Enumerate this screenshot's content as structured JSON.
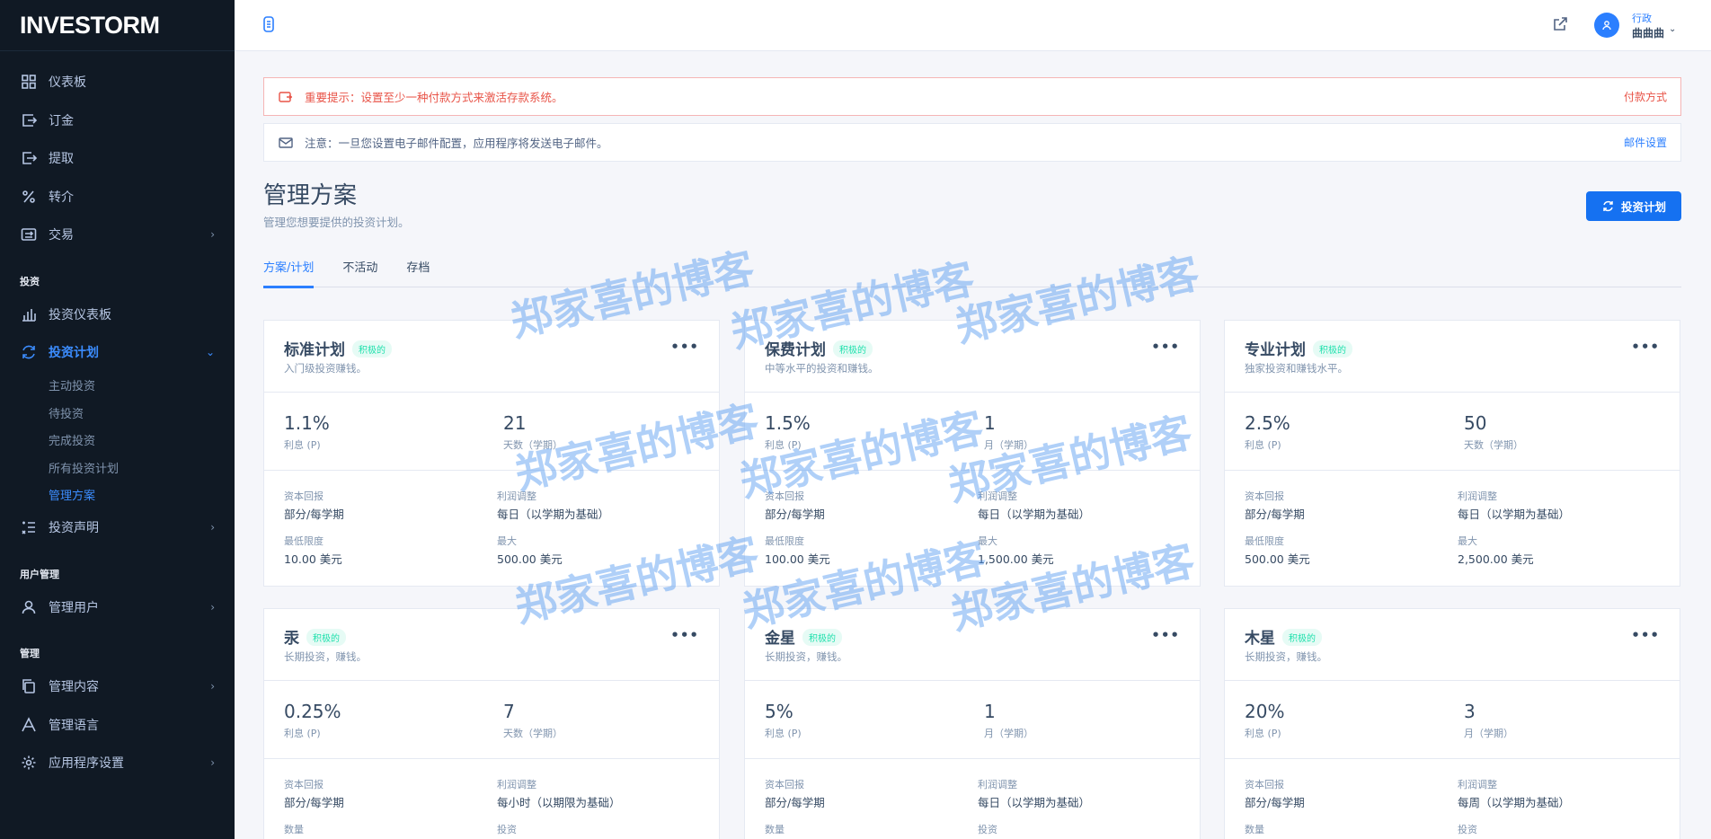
{
  "app": {
    "logo_text": "INVESTORM"
  },
  "sidebar": {
    "items_top": [
      {
        "label": "仪表板",
        "icon": "dashboard-icon"
      },
      {
        "label": "订金",
        "icon": "deposit-icon"
      },
      {
        "label": "提取",
        "icon": "withdraw-icon"
      },
      {
        "label": "转介",
        "icon": "percent-icon"
      },
      {
        "label": "交易",
        "icon": "transaction-icon"
      }
    ],
    "heading_invest": "投资",
    "items_invest": [
      {
        "label": "投资仪表板",
        "icon": "chart-bar-icon"
      },
      {
        "label": "投资计划",
        "icon": "refresh-icon"
      }
    ],
    "sub_items": [
      "主动投资",
      "待投资",
      "完成投资",
      "所有投资计划",
      "管理方案"
    ],
    "item_statement": {
      "label": "投资声明",
      "icon": "statement-icon"
    },
    "heading_users": "用户管理",
    "item_users": {
      "label": "管理用户",
      "icon": "user-icon"
    },
    "heading_manage": "管理",
    "items_manage": [
      {
        "label": "管理内容",
        "icon": "copy-icon"
      },
      {
        "label": "管理语言",
        "icon": "language-icon"
      },
      {
        "label": "应用程序设置",
        "icon": "gear-icon"
      }
    ]
  },
  "header": {
    "user_role": "行政",
    "user_name": "曲曲曲"
  },
  "alerts": {
    "danger_text": "重要提示：设置至少一种付款方式来激活存款系统。",
    "danger_link": "付款方式",
    "info_text": "注意：一旦您设置电子邮件配置，应用程序将发送电子邮件。",
    "info_link": "邮件设置"
  },
  "page": {
    "title": "管理方案",
    "subtitle": "管理您想要提供的投资计划。",
    "primary_button": "投资计划"
  },
  "tabs": [
    "方案/计划",
    "不活动",
    "存档"
  ],
  "labels": {
    "interest": "利息 (P)",
    "capital_return": "资本回报",
    "interest_adjust": "利润调整",
    "min_limit": "最低限度",
    "max": "最大",
    "quantity": "数量",
    "invest": "投资"
  },
  "plans": [
    {
      "name": "标准计划",
      "badge": "积极的",
      "desc": "入门级投资赚钱。",
      "interest": "1.1%",
      "term": "21",
      "term_label": "天数（学期）",
      "capital": "部分/每学期",
      "profit": "每日（以学期为基础）",
      "min": "10.00 美元",
      "max": "500.00 美元"
    },
    {
      "name": "保费计划",
      "badge": "积极的",
      "desc": "中等水平的投资和赚钱。",
      "interest": "1.5%",
      "term": "1",
      "term_label": "月（学期）",
      "capital": "部分/每学期",
      "profit": "每日（以学期为基础）",
      "min": "100.00 美元",
      "max": "1,500.00 美元"
    },
    {
      "name": "专业计划",
      "badge": "积极的",
      "desc": "独家投资和赚钱水平。",
      "interest": "2.5%",
      "term": "50",
      "term_label": "天数（学期）",
      "capital": "部分/每学期",
      "profit": "每日（以学期为基础）",
      "min": "500.00 美元",
      "max": "2,500.00 美元"
    },
    {
      "name": "汞",
      "badge": "积极的",
      "desc": "长期投资，赚钱。",
      "interest": "0.25%",
      "term": "7",
      "term_label": "天数（学期）",
      "capital": "部分/每学期",
      "profit": "每小时（以期限为基础）"
    },
    {
      "name": "金星",
      "badge": "积极的",
      "desc": "长期投资，赚钱。",
      "interest": "5%",
      "term": "1",
      "term_label": "月（学期）",
      "capital": "部分/每学期",
      "profit": "每日（以学期为基础）"
    },
    {
      "name": "木星",
      "badge": "积极的",
      "desc": "长期投资，赚钱。",
      "interest": "20%",
      "term": "3",
      "term_label": "月（学期）",
      "capital": "部分/每学期",
      "profit": "每周（以学期为基础）"
    }
  ],
  "watermark": "郑家喜的博客"
}
